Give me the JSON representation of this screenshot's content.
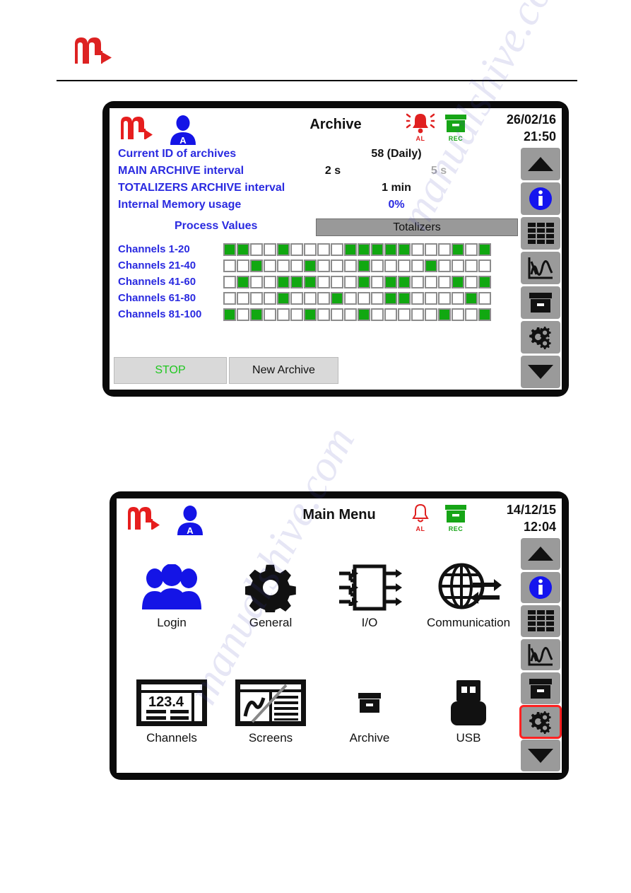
{
  "page": {
    "brand_logo": "m-logo-red",
    "watermark_text": "manualshive.com"
  },
  "screens": [
    {
      "id": "archive",
      "title": "Archive",
      "logo": "m-logo-red",
      "avatar": "user-avatar-a-icon",
      "status": {
        "alarm": {
          "icon": "bell-ringing-icon",
          "label": "AL",
          "color": "#e02020",
          "active": true
        },
        "rec": {
          "icon": "archive-box-icon",
          "label": "REC",
          "color": "#16a516",
          "active": true
        }
      },
      "date": "26/02/16",
      "time": "21:50",
      "info_rows": [
        {
          "label": "Current ID of archives",
          "value": "58 (Daily)",
          "value_color": "black",
          "secondary": ""
        },
        {
          "label": "MAIN ARCHIVE interval",
          "value": "2 s",
          "value_color": "black",
          "secondary": "5 s"
        },
        {
          "label": "TOTALIZERS ARCHIVE interval",
          "value": "1 min",
          "value_color": "black",
          "secondary": ""
        },
        {
          "label": "Internal Memory usage",
          "value": "0%",
          "value_color": "blue",
          "secondary": ""
        }
      ],
      "tabs": [
        {
          "label": "Process Values",
          "selected": false
        },
        {
          "label": "Totalizers",
          "selected": true
        }
      ],
      "channel_groups": [
        {
          "label": "Channels 1-20",
          "states": [
            1,
            1,
            0,
            0,
            1,
            0,
            0,
            0,
            0,
            1,
            1,
            1,
            1,
            1,
            0,
            0,
            0,
            1,
            0,
            1
          ]
        },
        {
          "label": "Channels 21-40",
          "states": [
            0,
            0,
            1,
            0,
            0,
            0,
            1,
            0,
            0,
            0,
            1,
            0,
            0,
            0,
            0,
            1,
            0,
            0,
            0,
            0
          ]
        },
        {
          "label": "Channels 41-60",
          "states": [
            0,
            1,
            0,
            0,
            1,
            1,
            1,
            0,
            0,
            0,
            1,
            0,
            1,
            1,
            0,
            0,
            0,
            1,
            0,
            1
          ]
        },
        {
          "label": "Channels 61-80",
          "states": [
            0,
            0,
            0,
            0,
            1,
            0,
            0,
            0,
            1,
            0,
            0,
            0,
            1,
            1,
            0,
            0,
            0,
            0,
            1,
            0
          ]
        },
        {
          "label": "Channels 81-100",
          "states": [
            1,
            0,
            1,
            0,
            0,
            0,
            1,
            0,
            0,
            0,
            1,
            0,
            0,
            0,
            0,
            0,
            1,
            0,
            0,
            1
          ]
        }
      ],
      "buttons": [
        {
          "label": "STOP",
          "style": "green-text"
        },
        {
          "label": "New Archive",
          "style": "default"
        }
      ],
      "toolbar": [
        {
          "icon": "arrow-up-icon",
          "name": "scroll-up-button",
          "selected": false
        },
        {
          "icon": "info-icon",
          "name": "info-button",
          "selected": false
        },
        {
          "icon": "table-grid-icon",
          "name": "table-view-button",
          "selected": false
        },
        {
          "icon": "chart-icon",
          "name": "chart-view-button",
          "selected": false
        },
        {
          "icon": "archive-box-icon",
          "name": "archive-button",
          "selected": false
        },
        {
          "icon": "gears-icon",
          "name": "settings-button",
          "selected": false
        },
        {
          "icon": "arrow-down-icon",
          "name": "scroll-down-button",
          "selected": false
        }
      ]
    },
    {
      "id": "mainmenu",
      "title": "Main Menu",
      "logo": "m-logo-red",
      "avatar": "user-avatar-a-icon",
      "status": {
        "alarm": {
          "icon": "bell-outline-icon",
          "label": "AL",
          "color": "#e02020",
          "active": false
        },
        "rec": {
          "icon": "archive-box-icon",
          "label": "REC",
          "color": "#16a516",
          "active": true
        }
      },
      "date": "14/12/15",
      "time": "12:04",
      "menu_items": [
        {
          "label": "Login",
          "icon": "users-group-icon",
          "color": "#1414e6"
        },
        {
          "label": "General",
          "icon": "gear-icon",
          "color": "#111111"
        },
        {
          "label": "I/O",
          "icon": "io-module-icon",
          "color": "#111111"
        },
        {
          "label": "Communication",
          "icon": "globe-exchange-icon",
          "color": "#111111"
        },
        {
          "label": "Channels",
          "icon": "display-123-icon",
          "color": "#111111"
        },
        {
          "label": "Screens",
          "icon": "screens-chart-icon",
          "color": "#111111"
        },
        {
          "label": "Archive",
          "icon": "archive-box-icon",
          "color": "#111111"
        },
        {
          "label": "USB",
          "icon": "usb-stick-icon",
          "color": "#111111"
        }
      ],
      "toolbar": [
        {
          "icon": "arrow-up-icon",
          "name": "scroll-up-button",
          "selected": false
        },
        {
          "icon": "info-icon",
          "name": "info-button",
          "selected": false
        },
        {
          "icon": "table-grid-icon",
          "name": "table-view-button",
          "selected": false
        },
        {
          "icon": "chart-icon",
          "name": "chart-view-button",
          "selected": false
        },
        {
          "icon": "archive-box-icon",
          "name": "archive-button",
          "selected": false
        },
        {
          "icon": "gears-icon",
          "name": "settings-button",
          "selected": true
        },
        {
          "icon": "arrow-down-icon",
          "name": "scroll-down-button",
          "selected": false
        }
      ]
    }
  ]
}
